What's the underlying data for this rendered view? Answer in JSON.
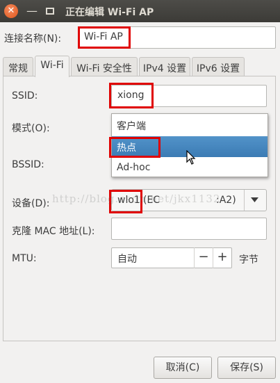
{
  "window": {
    "title": "正在编辑 Wi-Fi AP"
  },
  "connection_name": {
    "label": "连接名称(N):",
    "value": "Wi-Fi AP"
  },
  "tabs": [
    {
      "label": "常规"
    },
    {
      "label": "Wi-Fi"
    },
    {
      "label": "Wi-Fi 安全性"
    },
    {
      "label": "IPv4 设置"
    },
    {
      "label": "IPv6 设置"
    }
  ],
  "wifi": {
    "ssid_label": "SSID:",
    "ssid_value": "xiong",
    "mode_label": "模式(O):",
    "mode_options": [
      "客户端",
      "热点",
      "Ad-hoc"
    ],
    "mode_selected": "热点",
    "bssid_label": "BSSID:",
    "device_label": "设备(D):",
    "device_value_left": "wlo1",
    "device_value_mid": "(EC",
    "device_value_right": ":A2)",
    "clone_mac_label": "克隆 MAC 地址(L):",
    "mtu_label": "MTU:",
    "mtu_value": "自动",
    "mtu_minus": "−",
    "mtu_plus": "+",
    "mtu_unit": "字节"
  },
  "watermark": "http://blog.csdn.net/jkx1132",
  "buttons": {
    "cancel": "取消(C)",
    "save": "保存(S)"
  },
  "icons": {
    "close": "close-icon",
    "minimize": "minimize-icon",
    "maximize": "maximize-icon",
    "dropdown": "chevron-down-icon",
    "cursor": "pointer-cursor-icon"
  }
}
